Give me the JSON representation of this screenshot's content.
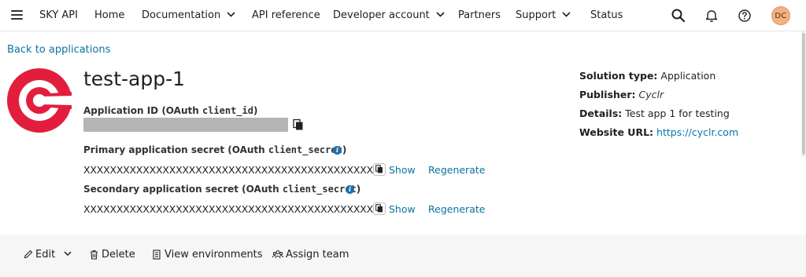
{
  "nav": {
    "brand": "SKY API",
    "items": [
      {
        "label": "Home",
        "has_dropdown": false
      },
      {
        "label": "Documentation",
        "has_dropdown": true
      },
      {
        "label": "API reference",
        "has_dropdown": false
      },
      {
        "label": "Developer account",
        "has_dropdown": true
      },
      {
        "label": "Partners",
        "has_dropdown": false
      },
      {
        "label": "Support",
        "has_dropdown": true
      },
      {
        "label": "Status",
        "has_dropdown": false
      }
    ],
    "icons": [
      "search-icon",
      "bell-icon",
      "help-icon"
    ],
    "avatar_initials": "DC"
  },
  "back_link": "Back to applications",
  "app": {
    "title": "test-app-1",
    "app_id_label": "Application ID (OAuth ",
    "app_id_code": "client_id",
    "app_id_close": ")",
    "primary_label": "Primary application secret (OAuth ",
    "primary_code": "client_secret",
    "primary_close": ")",
    "primary_value": "XXXXXXXXXXXXXXXXXXXXXXXXXXXXXXXXXXXXXXXXXXXX",
    "secondary_label": "Secondary application secret (OAuth ",
    "secondary_code": "client_secret",
    "secondary_close": ")",
    "secondary_value": "XXXXXXXXXXXXXXXXXXXXXXXXXXXXXXXXXXXXXXXXXXXX",
    "show_label": "Show",
    "regenerate_label": "Regenerate"
  },
  "details": {
    "solution_type_label": "Solution type:",
    "solution_type_value": "Application",
    "publisher_label": "Publisher:",
    "publisher_value": "Cyclr",
    "details_label": "Details:",
    "details_value": "Test app 1 for testing",
    "website_label": "Website URL:",
    "website_value": "https://cyclr.com"
  },
  "actions": {
    "edit": "Edit",
    "delete": "Delete",
    "view_environments": "View environments",
    "assign_team": "Assign team"
  },
  "colors": {
    "link": "#0974a1",
    "logo_red": "#e31e3d",
    "info_blue": "#1b6fb0",
    "avatar_bg": "#f4b183"
  }
}
